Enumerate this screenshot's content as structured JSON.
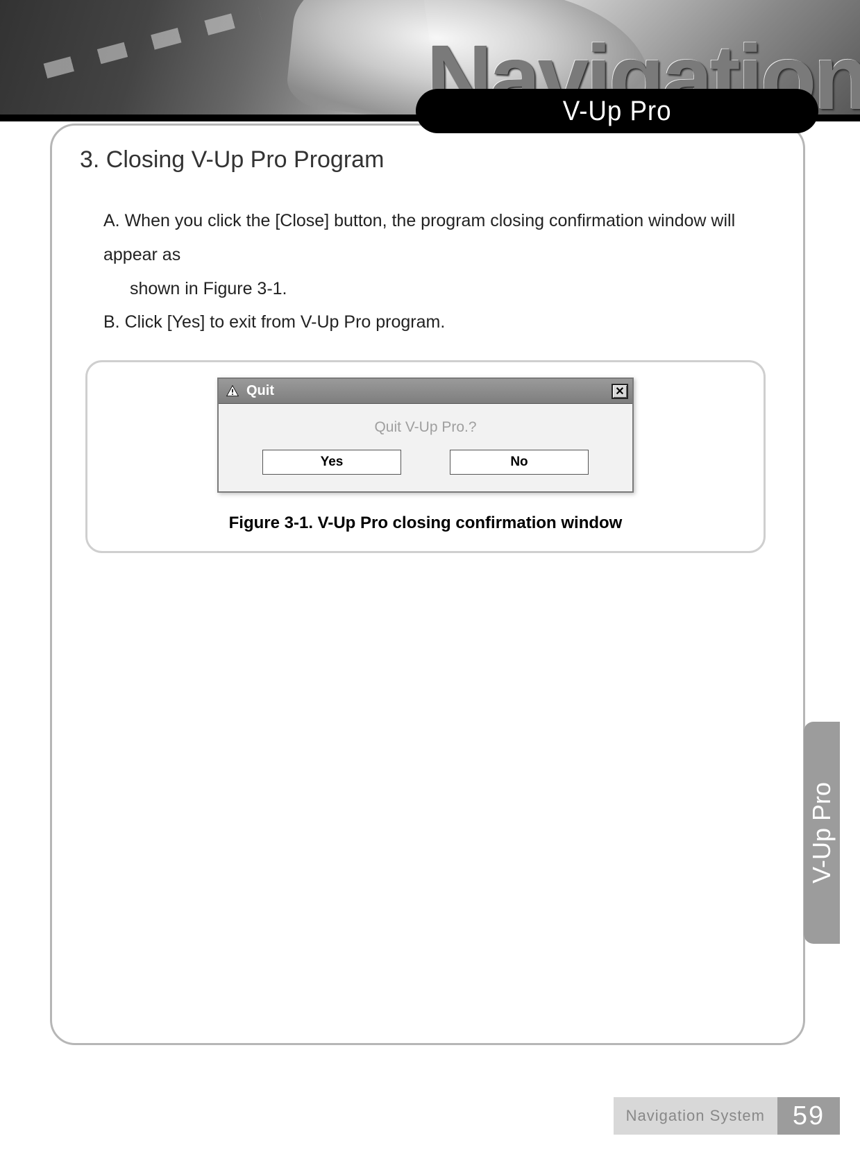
{
  "banner": {
    "background_word": "Navigation",
    "pill_label": "V-Up Pro"
  },
  "section": {
    "title": "3. Closing V-Up Pro Program",
    "para_a_line1": "A. When you click the [Close] button, the program closing confirmation window will appear as",
    "para_a_line2": "shown in Figure 3-1.",
    "para_b": "B. Click [Yes] to exit from V-Up Pro program."
  },
  "dialog": {
    "title": "Quit",
    "message": "Quit V-Up Pro.?",
    "yes_label": "Yes",
    "no_label": "No",
    "close_glyph": "✕"
  },
  "figure_caption": "Figure 3-1. V-Up Pro closing confirmation window",
  "side_tab": "V-Up Pro",
  "footer": {
    "label": "Navigation System",
    "page": "59"
  }
}
